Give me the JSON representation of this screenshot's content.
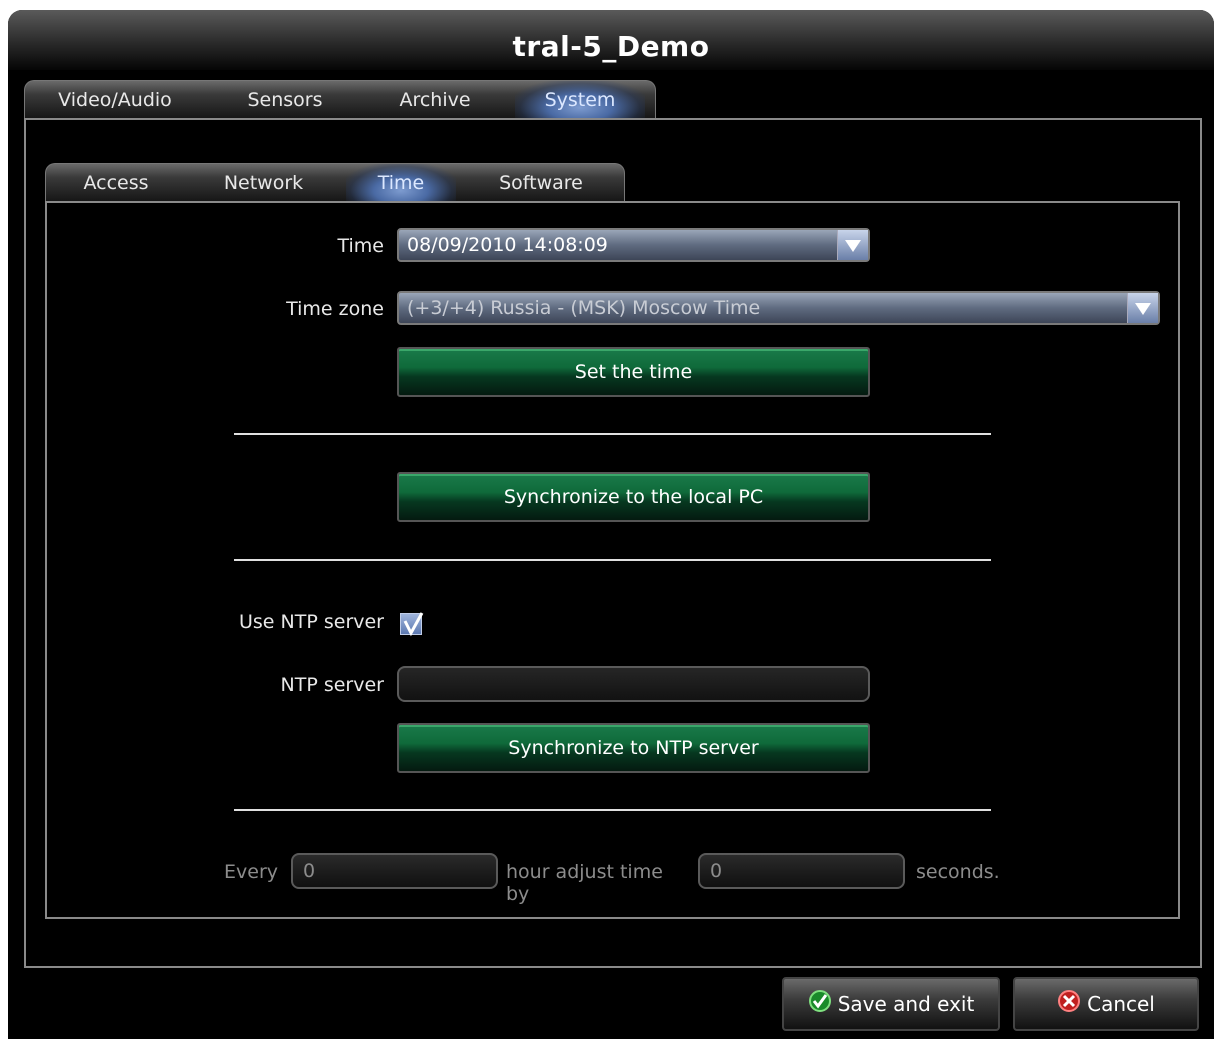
{
  "window": {
    "title": "tral-5_Demo"
  },
  "main_tabs": [
    {
      "label": "Video/Audio",
      "active": false
    },
    {
      "label": "Sensors",
      "active": false
    },
    {
      "label": "Archive",
      "active": false
    },
    {
      "label": "System",
      "active": true
    }
  ],
  "sub_tabs": [
    {
      "label": "Access",
      "active": false
    },
    {
      "label": "Network",
      "active": false
    },
    {
      "label": "Time",
      "active": true
    },
    {
      "label": "Software",
      "active": false
    }
  ],
  "time_panel": {
    "time_label": "Time",
    "time_value": "08/09/2010 14:08:09",
    "timezone_label": "Time zone",
    "timezone_value": "(+3/+4) Russia - (MSK) Moscow Time",
    "set_time_button": "Set the time",
    "sync_pc_button": "Synchronize to the local PC",
    "use_ntp_label": "Use NTP server",
    "use_ntp_checked": true,
    "ntp_server_label": "NTP server",
    "ntp_server_value": "",
    "sync_ntp_button": "Synchronize to NTP server",
    "every_label": "Every",
    "every_value": "0",
    "adjust_label": "hour adjust time by",
    "adjust_value": "0",
    "seconds_label": "seconds."
  },
  "footer": {
    "save_button": "Save and exit",
    "cancel_button": "Cancel"
  },
  "colors": {
    "accent_green": "#0f6a3a",
    "active_tab_blue": "#4a6aa4"
  },
  "icons": {
    "save": "check-circle-icon",
    "cancel": "cancel-circle-icon",
    "dropdown": "chevron-down-icon"
  }
}
